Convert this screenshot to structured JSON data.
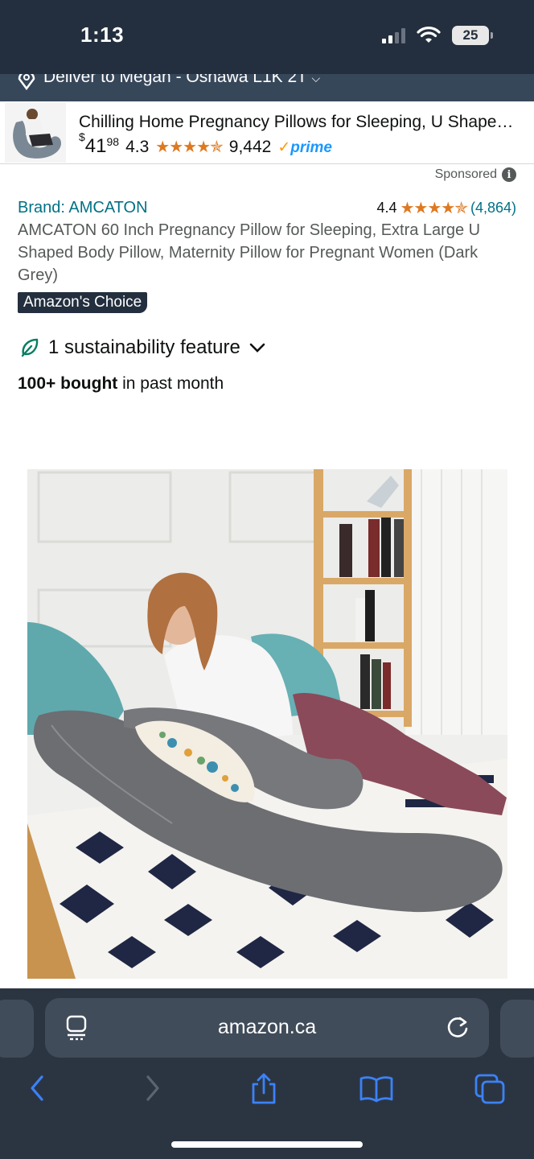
{
  "status_bar": {
    "time": "1:13",
    "battery": "25"
  },
  "deliver": {
    "text": "Deliver to Megan - Oshawa L1K 2T"
  },
  "sponsored_product": {
    "title": "Chilling Home Pregnancy Pillows for Sleeping, U Shape…",
    "price_symbol": "$",
    "price_whole": "41",
    "price_fraction": "98",
    "rating": "4.3",
    "stars": "★★★★✯",
    "review_count": "9,442",
    "prime_label": "prime",
    "thumb_icon": "pregnancy-pillow-thumbnail"
  },
  "sponsored_label": "Sponsored",
  "product": {
    "brand": "Brand: AMCATON",
    "rating": "4.4",
    "stars": "★★★★✯",
    "review_count": "(4,864)",
    "title": "AMCATON 60 Inch Pregnancy Pillow for Sleeping, Extra Large U Shaped Body Pillow, Maternity Pillow for Pregnant Women (Dark Grey)",
    "badge": "Amazon's Choice",
    "sustainability": "1 sustainability feature",
    "bought_bold": "100+ bought",
    "bought_rest": " in past month"
  },
  "browser": {
    "url": "amazon.ca"
  },
  "colors": {
    "header_bg": "#232f3e",
    "deliver_bg": "#37475a",
    "link": "#007185",
    "star": "#de7921",
    "prime": "#1a98ff",
    "browser_bg": "#2b3542",
    "ios_blue": "#3b82f6"
  }
}
